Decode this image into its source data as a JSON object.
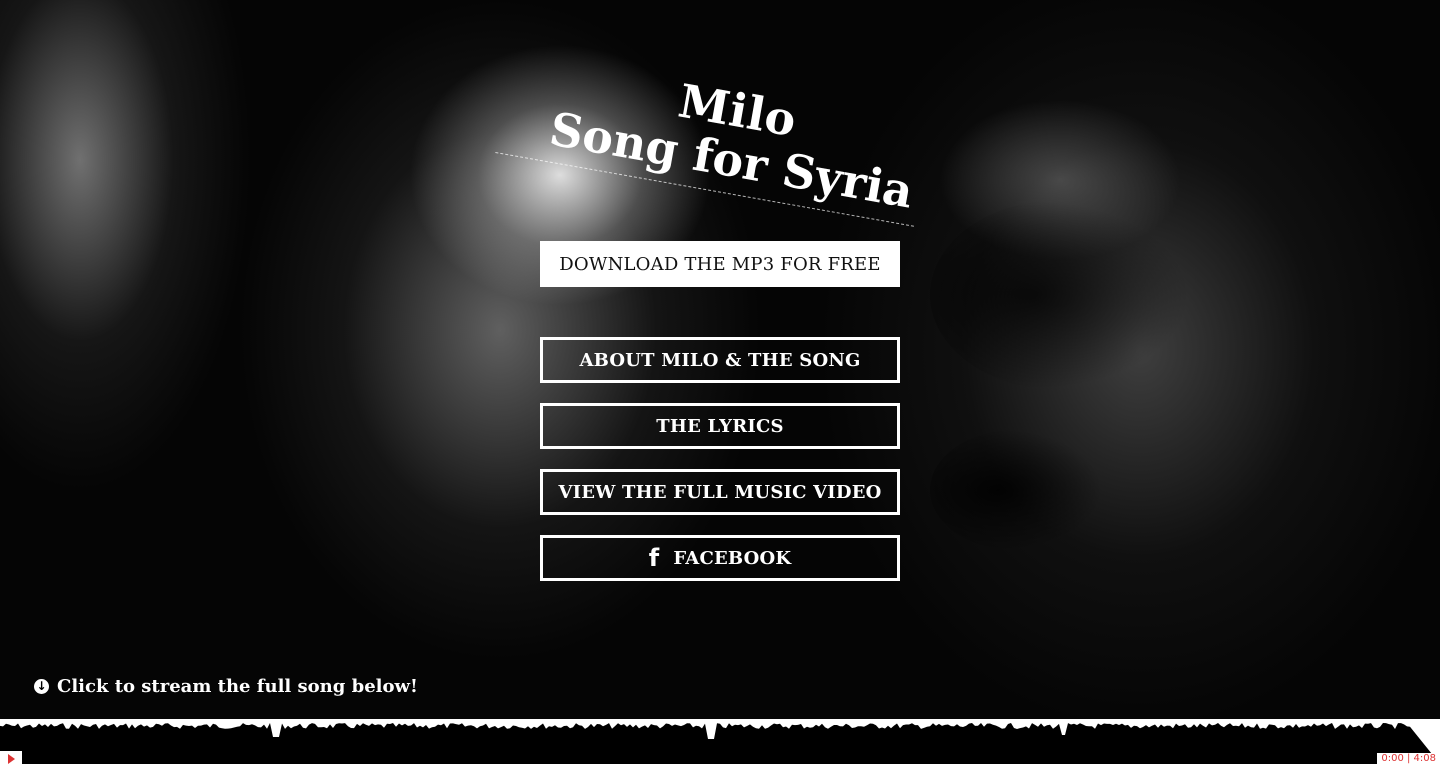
{
  "hero": {
    "artist": "Milo",
    "song_title": "Song for Syria"
  },
  "actions": {
    "download": "DOWNLOAD THE MP3 FOR FREE",
    "about": "ABOUT MILO & THE SONG",
    "lyrics": "THE LYRICS",
    "video": "VIEW THE FULL MUSIC VIDEO",
    "facebook": "FACEBOOK"
  },
  "icons": {
    "facebook": "facebook-icon",
    "stream_hint": "arrow-down-circle-icon",
    "play": "play-icon"
  },
  "stream_hint": "Click to stream the full song below!",
  "player": {
    "time": "0:00 | 4:08",
    "accent": "#dd3333",
    "waveform_color": "#000000"
  }
}
